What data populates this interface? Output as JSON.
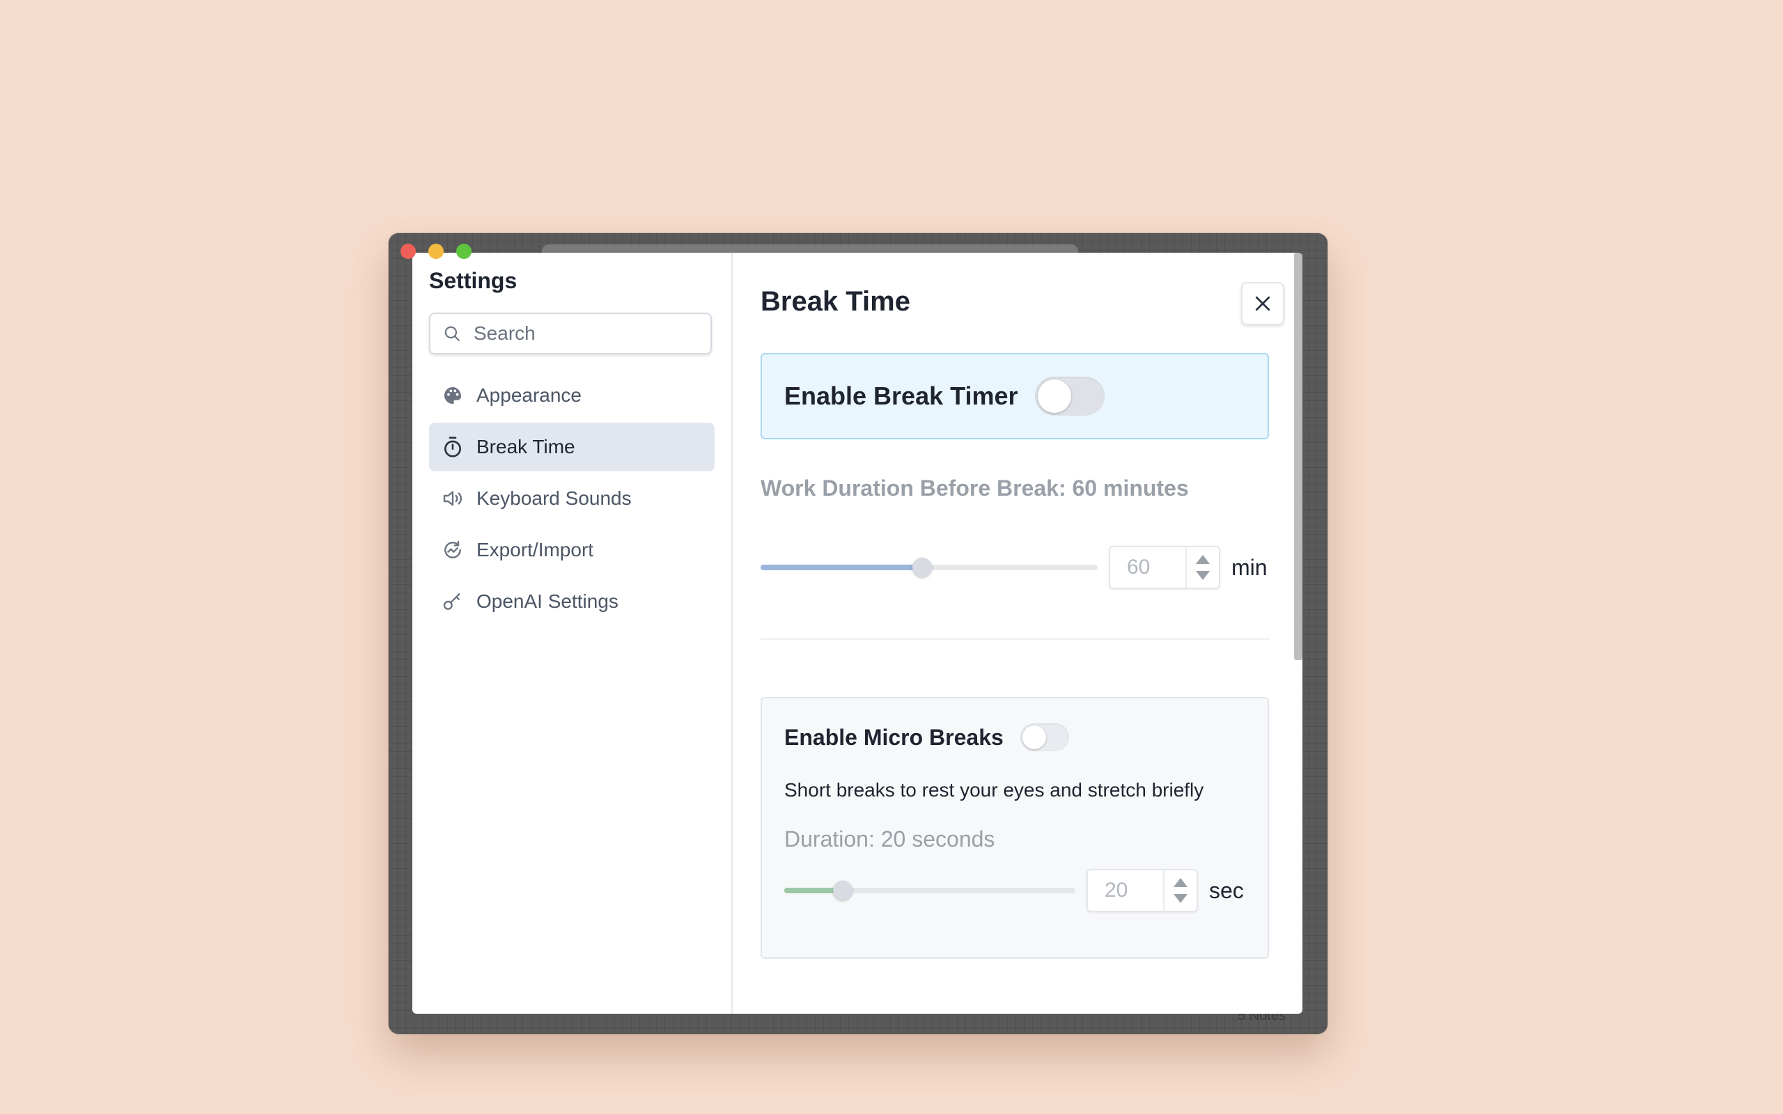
{
  "window": {
    "status_text": "5 Notes"
  },
  "sidebar": {
    "title": "Settings",
    "search_placeholder": "Search",
    "items": [
      {
        "label": "Appearance",
        "icon": "palette-icon",
        "active": false
      },
      {
        "label": "Break Time",
        "icon": "timer-icon",
        "active": true
      },
      {
        "label": "Keyboard Sounds",
        "icon": "speaker-icon",
        "active": false
      },
      {
        "label": "Export/Import",
        "icon": "sync-icon",
        "active": false
      },
      {
        "label": "OpenAI Settings",
        "icon": "key-icon",
        "active": false
      }
    ]
  },
  "main": {
    "title": "Break Time",
    "close_icon": "close-icon",
    "break_timer": {
      "label": "Enable Break Timer",
      "enabled": false
    },
    "work_duration": {
      "label": "Work Duration Before Break: 60 minutes",
      "value": "60",
      "unit": "min",
      "slider_fraction": 0.48,
      "fill_color": "#9ab5db"
    },
    "micro_breaks": {
      "label": "Enable Micro Breaks",
      "enabled": false,
      "description": "Short breaks to rest your eyes and stretch briefly",
      "duration_label": "Duration: 20 seconds",
      "value": "20",
      "unit": "sec",
      "slider_fraction": 0.2,
      "fill_color": "#9cc8a6"
    }
  },
  "colors": {
    "background": "#f6dccc",
    "window_chrome": "#595959",
    "active_nav": "#e2e7ef",
    "timer_card_bg": "#eaf6fd",
    "timer_card_border": "#a9d8f2"
  }
}
